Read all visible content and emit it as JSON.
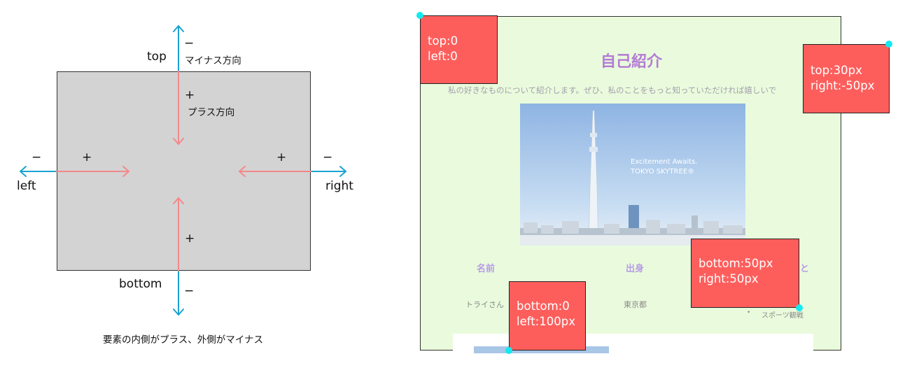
{
  "left_diagram": {
    "label_top": "top",
    "label_bottom": "bottom",
    "label_left": "left",
    "label_right": "right",
    "minus": "−",
    "plus": "+",
    "minus_direction": "マイナス方向",
    "plus_direction": "プラス方向",
    "caption": "要素の内側がプラス、外側がマイナス"
  },
  "right_mockup": {
    "page_title": "自己紹介",
    "intro": "私の好きなものについて紹介します。ぜひ、私のことをもっと知っていただければ嬉しいで",
    "photo_caption_line1": "Excitement Awaits.",
    "photo_caption_line2": "TOKYO SKYTREE®",
    "col_name": "名前",
    "col_origin": "出身",
    "col_third_fragment": "と",
    "val_name": "トライさん",
    "val_origin": "東京都",
    "val_hobby": "スポーツ観戦",
    "bullet": "•",
    "boxes": {
      "top_left": [
        "top:0",
        "left:0"
      ],
      "top_right": [
        "top:30px",
        "right:-50px"
      ],
      "bottom_right": [
        "bottom:50px",
        "right:50px"
      ],
      "bottom_left": [
        "bottom:0",
        "left:100px"
      ]
    }
  },
  "colors": {
    "arrow_outward": "#1aa3d2",
    "arrow_inward": "#f4888a",
    "box_red": "#fd5e5c",
    "anchor_dot": "#15e9f0",
    "page_bg": "#e9fbdc",
    "title_purple": "#b47bd6"
  }
}
